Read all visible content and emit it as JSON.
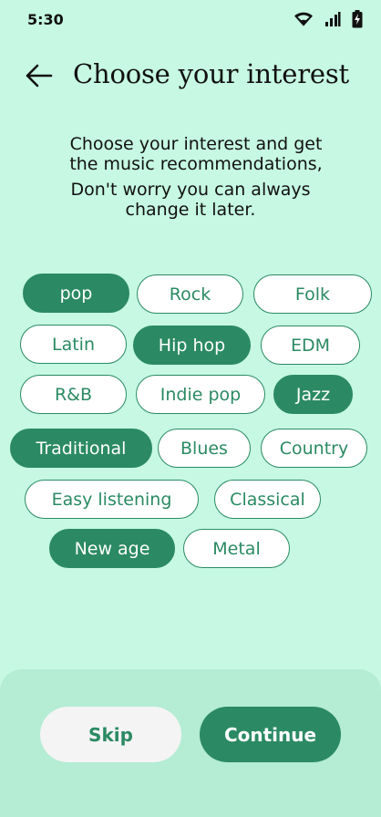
{
  "status_bar": {
    "time": "5:30",
    "icons": [
      "wifi-icon",
      "signal-icon",
      "battery-charging-icon"
    ]
  },
  "header": {
    "back_icon": "arrow-left-icon",
    "title": "Choose your interest"
  },
  "description": {
    "line1": "Choose your interest and get",
    "line2": "the  music recommendations,",
    "line3": "Don't worry you can always",
    "line4": "change it later."
  },
  "interests": [
    {
      "label": "pop",
      "selected": true
    },
    {
      "label": "Rock",
      "selected": false
    },
    {
      "label": "Folk",
      "selected": false
    },
    {
      "label": "Latin",
      "selected": false
    },
    {
      "label": "Hip hop",
      "selected": true
    },
    {
      "label": "EDM",
      "selected": false
    },
    {
      "label": "R&B",
      "selected": false
    },
    {
      "label": "Indie pop",
      "selected": false
    },
    {
      "label": "Jazz",
      "selected": true
    },
    {
      "label": "Traditional",
      "selected": true
    },
    {
      "label": "Blues",
      "selected": false
    },
    {
      "label": "Country",
      "selected": false
    },
    {
      "label": "Easy listening",
      "selected": false
    },
    {
      "label": "Classical",
      "selected": false
    },
    {
      "label": "New age",
      "selected": true
    },
    {
      "label": "Metal",
      "selected": false
    }
  ],
  "actions": {
    "skip_label": "Skip",
    "continue_label": "Continue"
  },
  "colors": {
    "background": "#c6f8e3",
    "accent": "#2b8a63",
    "sheet": "#b4ecd4",
    "skip_bg": "#f4f4f4"
  }
}
